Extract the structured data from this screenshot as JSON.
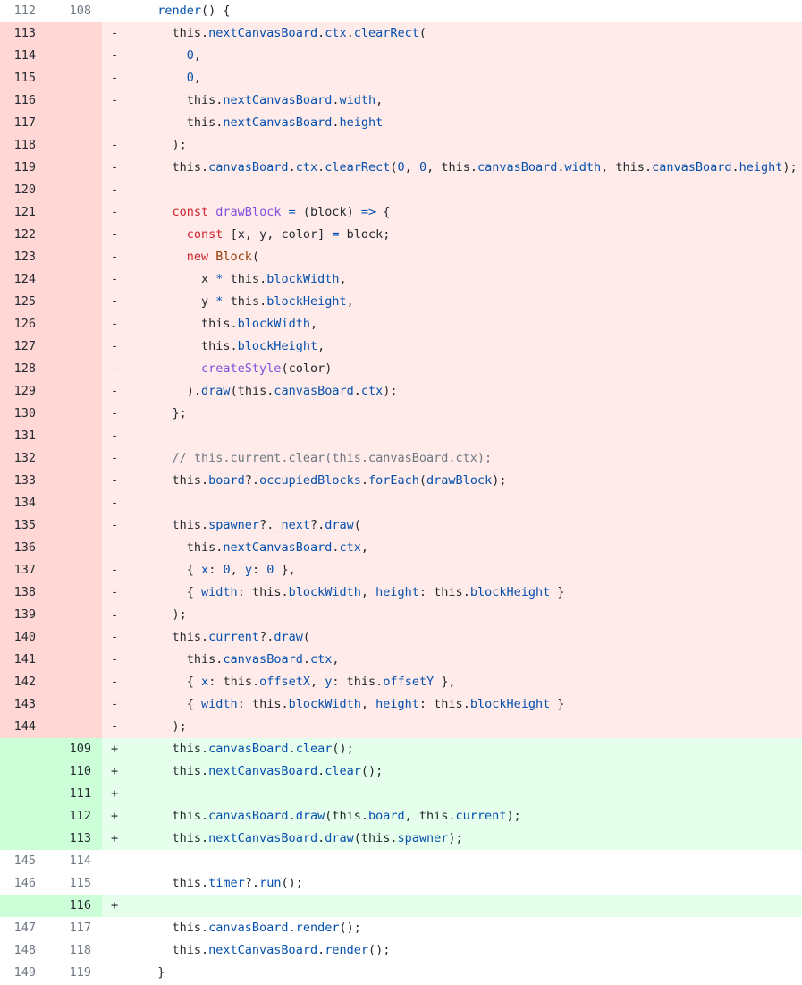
{
  "colors": {
    "deleted_bg": "#ffebe9",
    "deleted_gutter": "#ffd7d5",
    "added_bg": "#e6ffec",
    "added_gutter": "#ccffd8",
    "keyword": "#cf222e",
    "function": "#8250df",
    "property": "#0550ae",
    "comment": "#6e7781",
    "class": "#953800"
  },
  "lines": [
    {
      "type": "ctx",
      "old": "112",
      "new": "108",
      "marker": "",
      "tokens": [
        [
          "render",
          "prop"
        ],
        [
          "() {",
          "plain"
        ]
      ],
      "indent": "  "
    },
    {
      "type": "del",
      "old": "113",
      "new": "",
      "marker": "-",
      "tokens": [
        [
          "this.",
          "plain"
        ],
        [
          "nextCanvasBoard",
          "prop"
        ],
        [
          ".",
          "plain"
        ],
        [
          "ctx",
          "prop"
        ],
        [
          ".",
          "plain"
        ],
        [
          "clearRect",
          "prop"
        ],
        [
          "(",
          "plain"
        ]
      ],
      "indent": "    "
    },
    {
      "type": "del",
      "old": "114",
      "new": "",
      "marker": "-",
      "tokens": [
        [
          "0",
          "num"
        ],
        [
          ",",
          "plain"
        ]
      ],
      "indent": "      "
    },
    {
      "type": "del",
      "old": "115",
      "new": "",
      "marker": "-",
      "tokens": [
        [
          "0",
          "num"
        ],
        [
          ",",
          "plain"
        ]
      ],
      "indent": "      "
    },
    {
      "type": "del",
      "old": "116",
      "new": "",
      "marker": "-",
      "tokens": [
        [
          "this.",
          "plain"
        ],
        [
          "nextCanvasBoard",
          "prop"
        ],
        [
          ".",
          "plain"
        ],
        [
          "width",
          "prop"
        ],
        [
          ",",
          "plain"
        ]
      ],
      "indent": "      "
    },
    {
      "type": "del",
      "old": "117",
      "new": "",
      "marker": "-",
      "tokens": [
        [
          "this.",
          "plain"
        ],
        [
          "nextCanvasBoard",
          "prop"
        ],
        [
          ".",
          "plain"
        ],
        [
          "height",
          "prop"
        ]
      ],
      "indent": "      "
    },
    {
      "type": "del",
      "old": "118",
      "new": "",
      "marker": "-",
      "tokens": [
        [
          ");",
          "plain"
        ]
      ],
      "indent": "    "
    },
    {
      "type": "del",
      "old": "119",
      "new": "",
      "marker": "-",
      "tokens": [
        [
          "this.",
          "plain"
        ],
        [
          "canvasBoard",
          "prop"
        ],
        [
          ".",
          "plain"
        ],
        [
          "ctx",
          "prop"
        ],
        [
          ".",
          "plain"
        ],
        [
          "clearRect",
          "prop"
        ],
        [
          "(",
          "plain"
        ],
        [
          "0",
          "num"
        ],
        [
          ", ",
          "plain"
        ],
        [
          "0",
          "num"
        ],
        [
          ", this.",
          "plain"
        ],
        [
          "canvasBoard",
          "prop"
        ],
        [
          ".",
          "plain"
        ],
        [
          "width",
          "prop"
        ],
        [
          ", this.",
          "plain"
        ],
        [
          "canvasBoard",
          "prop"
        ],
        [
          ".",
          "plain"
        ],
        [
          "height",
          "prop"
        ],
        [
          ");",
          "plain"
        ]
      ],
      "indent": "    "
    },
    {
      "type": "del",
      "old": "120",
      "new": "",
      "marker": "-",
      "tokens": [],
      "indent": ""
    },
    {
      "type": "del",
      "old": "121",
      "new": "",
      "marker": "-",
      "tokens": [
        [
          "const ",
          "kw"
        ],
        [
          "drawBlock",
          "fn"
        ],
        [
          " ",
          "plain"
        ],
        [
          "=",
          "op"
        ],
        [
          " (block) ",
          "plain"
        ],
        [
          "=>",
          "op"
        ],
        [
          " {",
          "plain"
        ]
      ],
      "indent": "    "
    },
    {
      "type": "del",
      "old": "122",
      "new": "",
      "marker": "-",
      "tokens": [
        [
          "const ",
          "kw"
        ],
        [
          "[x, y, color] ",
          "plain"
        ],
        [
          "=",
          "op"
        ],
        [
          " block;",
          "plain"
        ]
      ],
      "indent": "      "
    },
    {
      "type": "del",
      "old": "123",
      "new": "",
      "marker": "-",
      "tokens": [
        [
          "new ",
          "kw"
        ],
        [
          "Block",
          "cls"
        ],
        [
          "(",
          "plain"
        ]
      ],
      "indent": "      "
    },
    {
      "type": "del",
      "old": "124",
      "new": "",
      "marker": "-",
      "tokens": [
        [
          "x ",
          "plain"
        ],
        [
          "*",
          "op"
        ],
        [
          " this.",
          "plain"
        ],
        [
          "blockWidth",
          "prop"
        ],
        [
          ",",
          "plain"
        ]
      ],
      "indent": "        "
    },
    {
      "type": "del",
      "old": "125",
      "new": "",
      "marker": "-",
      "tokens": [
        [
          "y ",
          "plain"
        ],
        [
          "*",
          "op"
        ],
        [
          " this.",
          "plain"
        ],
        [
          "blockHeight",
          "prop"
        ],
        [
          ",",
          "plain"
        ]
      ],
      "indent": "        "
    },
    {
      "type": "del",
      "old": "126",
      "new": "",
      "marker": "-",
      "tokens": [
        [
          "this.",
          "plain"
        ],
        [
          "blockWidth",
          "prop"
        ],
        [
          ",",
          "plain"
        ]
      ],
      "indent": "        "
    },
    {
      "type": "del",
      "old": "127",
      "new": "",
      "marker": "-",
      "tokens": [
        [
          "this.",
          "plain"
        ],
        [
          "blockHeight",
          "prop"
        ],
        [
          ",",
          "plain"
        ]
      ],
      "indent": "        "
    },
    {
      "type": "del",
      "old": "128",
      "new": "",
      "marker": "-",
      "tokens": [
        [
          "createStyle",
          "fn"
        ],
        [
          "(color)",
          "plain"
        ]
      ],
      "indent": "        "
    },
    {
      "type": "del",
      "old": "129",
      "new": "",
      "marker": "-",
      "tokens": [
        [
          ").",
          "plain"
        ],
        [
          "draw",
          "prop"
        ],
        [
          "(this.",
          "plain"
        ],
        [
          "canvasBoard",
          "prop"
        ],
        [
          ".",
          "plain"
        ],
        [
          "ctx",
          "prop"
        ],
        [
          ");",
          "plain"
        ]
      ],
      "indent": "      "
    },
    {
      "type": "del",
      "old": "130",
      "new": "",
      "marker": "-",
      "tokens": [
        [
          "};",
          "plain"
        ]
      ],
      "indent": "    "
    },
    {
      "type": "del",
      "old": "131",
      "new": "",
      "marker": "-",
      "tokens": [],
      "indent": ""
    },
    {
      "type": "del",
      "old": "132",
      "new": "",
      "marker": "-",
      "tokens": [
        [
          "// this.current.clear(this.canvasBoard.ctx);",
          "cm"
        ]
      ],
      "indent": "    "
    },
    {
      "type": "del",
      "old": "133",
      "new": "",
      "marker": "-",
      "tokens": [
        [
          "this.",
          "plain"
        ],
        [
          "board",
          "prop"
        ],
        [
          "?.",
          "plain"
        ],
        [
          "occupiedBlocks",
          "prop"
        ],
        [
          ".",
          "plain"
        ],
        [
          "forEach",
          "prop"
        ],
        [
          "(",
          "plain"
        ],
        [
          "drawBlock",
          "prop"
        ],
        [
          ");",
          "plain"
        ]
      ],
      "indent": "    "
    },
    {
      "type": "del",
      "old": "134",
      "new": "",
      "marker": "-",
      "tokens": [],
      "indent": ""
    },
    {
      "type": "del",
      "old": "135",
      "new": "",
      "marker": "-",
      "tokens": [
        [
          "this.",
          "plain"
        ],
        [
          "spawner",
          "prop"
        ],
        [
          "?.",
          "plain"
        ],
        [
          "_next",
          "prop"
        ],
        [
          "?.",
          "plain"
        ],
        [
          "draw",
          "prop"
        ],
        [
          "(",
          "plain"
        ]
      ],
      "indent": "    "
    },
    {
      "type": "del",
      "old": "136",
      "new": "",
      "marker": "-",
      "tokens": [
        [
          "this.",
          "plain"
        ],
        [
          "nextCanvasBoard",
          "prop"
        ],
        [
          ".",
          "plain"
        ],
        [
          "ctx",
          "prop"
        ],
        [
          ",",
          "plain"
        ]
      ],
      "indent": "      "
    },
    {
      "type": "del",
      "old": "137",
      "new": "",
      "marker": "-",
      "tokens": [
        [
          "{ ",
          "plain"
        ],
        [
          "x",
          "prop"
        ],
        [
          ": ",
          "plain"
        ],
        [
          "0",
          "num"
        ],
        [
          ", ",
          "plain"
        ],
        [
          "y",
          "prop"
        ],
        [
          ": ",
          "plain"
        ],
        [
          "0",
          "num"
        ],
        [
          " },",
          "plain"
        ]
      ],
      "indent": "      "
    },
    {
      "type": "del",
      "old": "138",
      "new": "",
      "marker": "-",
      "tokens": [
        [
          "{ ",
          "plain"
        ],
        [
          "width",
          "prop"
        ],
        [
          ": this.",
          "plain"
        ],
        [
          "blockWidth",
          "prop"
        ],
        [
          ", ",
          "plain"
        ],
        [
          "height",
          "prop"
        ],
        [
          ": this.",
          "plain"
        ],
        [
          "blockHeight",
          "prop"
        ],
        [
          " }",
          "plain"
        ]
      ],
      "indent": "      "
    },
    {
      "type": "del",
      "old": "139",
      "new": "",
      "marker": "-",
      "tokens": [
        [
          ");",
          "plain"
        ]
      ],
      "indent": "    "
    },
    {
      "type": "del",
      "old": "140",
      "new": "",
      "marker": "-",
      "tokens": [
        [
          "this.",
          "plain"
        ],
        [
          "current",
          "prop"
        ],
        [
          "?.",
          "plain"
        ],
        [
          "draw",
          "prop"
        ],
        [
          "(",
          "plain"
        ]
      ],
      "indent": "    "
    },
    {
      "type": "del",
      "old": "141",
      "new": "",
      "marker": "-",
      "tokens": [
        [
          "this.",
          "plain"
        ],
        [
          "canvasBoard",
          "prop"
        ],
        [
          ".",
          "plain"
        ],
        [
          "ctx",
          "prop"
        ],
        [
          ",",
          "plain"
        ]
      ],
      "indent": "      "
    },
    {
      "type": "del",
      "old": "142",
      "new": "",
      "marker": "-",
      "tokens": [
        [
          "{ ",
          "plain"
        ],
        [
          "x",
          "prop"
        ],
        [
          ": this.",
          "plain"
        ],
        [
          "offsetX",
          "prop"
        ],
        [
          ", ",
          "plain"
        ],
        [
          "y",
          "prop"
        ],
        [
          ": this.",
          "plain"
        ],
        [
          "offsetY",
          "prop"
        ],
        [
          " },",
          "plain"
        ]
      ],
      "indent": "      "
    },
    {
      "type": "del",
      "old": "143",
      "new": "",
      "marker": "-",
      "tokens": [
        [
          "{ ",
          "plain"
        ],
        [
          "width",
          "prop"
        ],
        [
          ": this.",
          "plain"
        ],
        [
          "blockWidth",
          "prop"
        ],
        [
          ", ",
          "plain"
        ],
        [
          "height",
          "prop"
        ],
        [
          ": this.",
          "plain"
        ],
        [
          "blockHeight",
          "prop"
        ],
        [
          " }",
          "plain"
        ]
      ],
      "indent": "      "
    },
    {
      "type": "del",
      "old": "144",
      "new": "",
      "marker": "-",
      "tokens": [
        [
          ");",
          "plain"
        ]
      ],
      "indent": "    "
    },
    {
      "type": "add",
      "old": "",
      "new": "109",
      "marker": "+",
      "tokens": [
        [
          "this.",
          "plain"
        ],
        [
          "canvasBoard",
          "prop"
        ],
        [
          ".",
          "plain"
        ],
        [
          "clear",
          "prop"
        ],
        [
          "();",
          "plain"
        ]
      ],
      "indent": "    "
    },
    {
      "type": "add",
      "old": "",
      "new": "110",
      "marker": "+",
      "tokens": [
        [
          "this.",
          "plain"
        ],
        [
          "nextCanvasBoard",
          "prop"
        ],
        [
          ".",
          "plain"
        ],
        [
          "clear",
          "prop"
        ],
        [
          "();",
          "plain"
        ]
      ],
      "indent": "    "
    },
    {
      "type": "add",
      "old": "",
      "new": "111",
      "marker": "+",
      "tokens": [],
      "indent": ""
    },
    {
      "type": "add",
      "old": "",
      "new": "112",
      "marker": "+",
      "tokens": [
        [
          "this.",
          "plain"
        ],
        [
          "canvasBoard",
          "prop"
        ],
        [
          ".",
          "plain"
        ],
        [
          "draw",
          "prop"
        ],
        [
          "(this.",
          "plain"
        ],
        [
          "board",
          "prop"
        ],
        [
          ", this.",
          "plain"
        ],
        [
          "current",
          "prop"
        ],
        [
          ");",
          "plain"
        ]
      ],
      "indent": "    "
    },
    {
      "type": "add",
      "old": "",
      "new": "113",
      "marker": "+",
      "tokens": [
        [
          "this.",
          "plain"
        ],
        [
          "nextCanvasBoard",
          "prop"
        ],
        [
          ".",
          "plain"
        ],
        [
          "draw",
          "prop"
        ],
        [
          "(this.",
          "plain"
        ],
        [
          "spawner",
          "prop"
        ],
        [
          ");",
          "plain"
        ]
      ],
      "indent": "    "
    },
    {
      "type": "ctx",
      "old": "145",
      "new": "114",
      "marker": "",
      "tokens": [],
      "indent": ""
    },
    {
      "type": "ctx",
      "old": "146",
      "new": "115",
      "marker": "",
      "tokens": [
        [
          "this.",
          "plain"
        ],
        [
          "timer",
          "prop"
        ],
        [
          "?.",
          "plain"
        ],
        [
          "run",
          "prop"
        ],
        [
          "();",
          "plain"
        ]
      ],
      "indent": "    "
    },
    {
      "type": "add",
      "old": "",
      "new": "116",
      "marker": "+",
      "tokens": [],
      "indent": ""
    },
    {
      "type": "ctx",
      "old": "147",
      "new": "117",
      "marker": "",
      "tokens": [
        [
          "this.",
          "plain"
        ],
        [
          "canvasBoard",
          "prop"
        ],
        [
          ".",
          "plain"
        ],
        [
          "render",
          "prop"
        ],
        [
          "();",
          "plain"
        ]
      ],
      "indent": "    "
    },
    {
      "type": "ctx",
      "old": "148",
      "new": "118",
      "marker": "",
      "tokens": [
        [
          "this.",
          "plain"
        ],
        [
          "nextCanvasBoard",
          "prop"
        ],
        [
          ".",
          "plain"
        ],
        [
          "render",
          "prop"
        ],
        [
          "();",
          "plain"
        ]
      ],
      "indent": "    "
    },
    {
      "type": "ctx",
      "old": "149",
      "new": "119",
      "marker": "",
      "tokens": [
        [
          "}",
          "plain"
        ]
      ],
      "indent": "  "
    }
  ]
}
